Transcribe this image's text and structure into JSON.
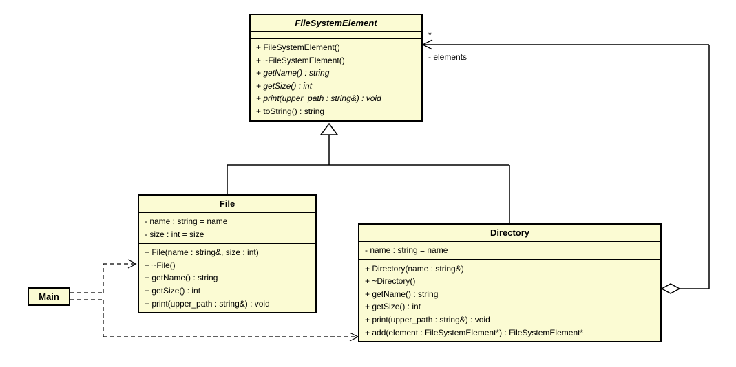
{
  "classes": {
    "fse": {
      "name": "FileSystemElement",
      "abstract": true,
      "attributes": [],
      "operations": [
        {
          "text": "+ FileSystemElement()",
          "abstract": false
        },
        {
          "text": "+ ~FileSystemElement()",
          "abstract": false
        },
        {
          "text": "+ getName() : string",
          "abstract": true
        },
        {
          "text": "+ getSize() : int",
          "abstract": true
        },
        {
          "text": "+ print(upper_path : string&) : void",
          "abstract": true
        },
        {
          "text": "+ toString() : string",
          "abstract": false
        }
      ]
    },
    "file": {
      "name": "File",
      "abstract": false,
      "attributes": [
        "- name : string = name",
        "- size : int = size"
      ],
      "operations": [
        {
          "text": "+ File(name : string&, size : int)",
          "abstract": false
        },
        {
          "text": "+ ~File()",
          "abstract": false
        },
        {
          "text": "+ getName() : string",
          "abstract": false
        },
        {
          "text": "+ getSize() : int",
          "abstract": false
        },
        {
          "text": "+ print(upper_path : string&) : void",
          "abstract": false
        }
      ]
    },
    "directory": {
      "name": "Directory",
      "abstract": false,
      "attributes": [
        "- name : string = name"
      ],
      "operations": [
        {
          "text": "+ Directory(name : string&)",
          "abstract": false
        },
        {
          "text": "+ ~Directory()",
          "abstract": false
        },
        {
          "text": "+ getName() : string",
          "abstract": false
        },
        {
          "text": "+ getSize() : int",
          "abstract": false
        },
        {
          "text": "+ print(upper_path : string&) : void",
          "abstract": false
        },
        {
          "text": "+ add(element : FileSystemElement*) : FileSystemElement*",
          "abstract": false
        }
      ]
    },
    "main": {
      "name": "Main"
    }
  },
  "relations": {
    "aggregation": {
      "mult": "*",
      "role": "- elements"
    }
  }
}
